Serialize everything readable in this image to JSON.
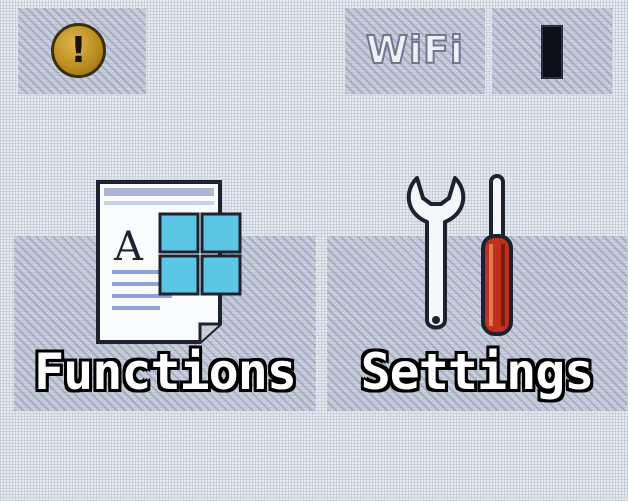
{
  "status_bar": {
    "alert_symbol": "!",
    "wifi_label": "WiFi",
    "battery_icon": "battery-icon"
  },
  "main_menu": {
    "functions_label": "Functions",
    "settings_label": "Settings"
  },
  "colors": {
    "alert": "#c99a2c",
    "grid_tile": "#5bc6e6",
    "screwdriver_handle": "#c0301c"
  }
}
